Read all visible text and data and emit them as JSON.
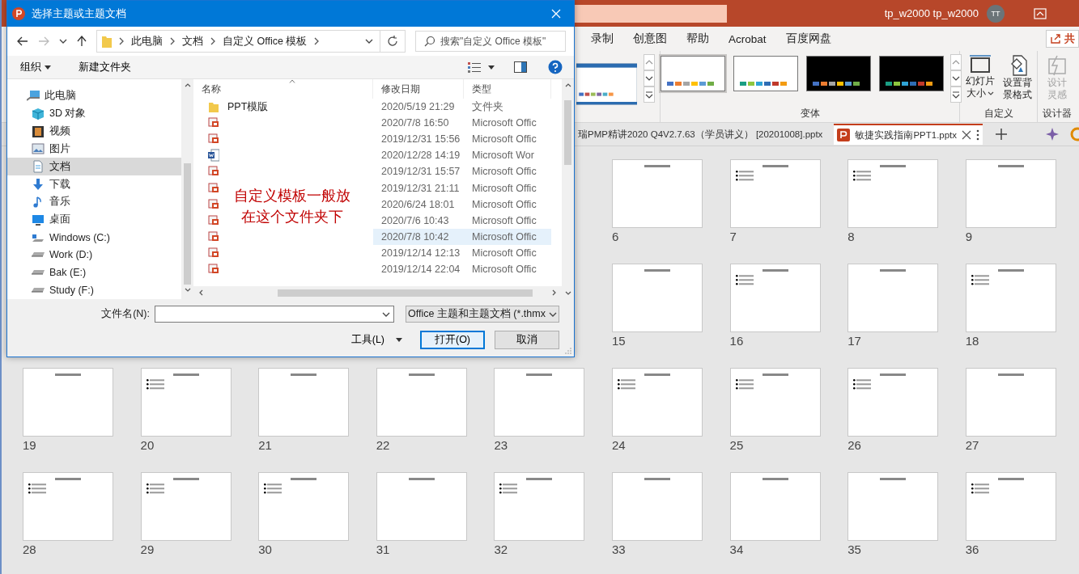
{
  "app": {
    "user": "tp_w2000 tp_w2000",
    "avatar": "TT"
  },
  "ribbon_tabs": [
    {
      "label": "录制"
    },
    {
      "label": "创意图"
    },
    {
      "label": "帮助"
    },
    {
      "label": "Acrobat"
    },
    {
      "label": "百度网盘"
    }
  ],
  "share_button": "共",
  "variants": {
    "label": "变体",
    "items": [
      {
        "kind": "light",
        "selected": true
      },
      {
        "kind": "light",
        "selected": false
      },
      {
        "kind": "dark",
        "selected": false
      },
      {
        "kind": "dark",
        "selected": false
      }
    ]
  },
  "customize": {
    "label": "自定义",
    "buttons": [
      {
        "kind": "size",
        "lines": [
          "幻灯片",
          "大小"
        ],
        "dropdown": true
      },
      {
        "kind": "background",
        "lines": [
          "设置背",
          "景格式"
        ],
        "dropdown": false
      }
    ]
  },
  "designer": {
    "label": "设计器",
    "button": {
      "lines": [
        "设计",
        "灵感"
      ],
      "disabled": true
    }
  },
  "doc_tabs": [
    {
      "label": "瑞PMP精讲2020 Q4V2.7.63（学员讲义） [20201008].pptx",
      "selected": false
    },
    {
      "label": "敏捷实践指南PPT1.pptx",
      "selected": true
    }
  ],
  "slides": [
    {
      "number": "6",
      "kind": "title"
    },
    {
      "number": "7",
      "kind": "bullets"
    },
    {
      "number": "8",
      "kind": "bullets"
    },
    {
      "number": "9",
      "kind": "title"
    },
    {
      "number": "15",
      "kind": "title"
    },
    {
      "number": "16",
      "kind": "bullets"
    },
    {
      "number": "17",
      "kind": "title"
    },
    {
      "number": "18",
      "kind": "bullets"
    },
    {
      "number": "19",
      "kind": "title"
    },
    {
      "number": "20",
      "kind": "bullets"
    },
    {
      "number": "21",
      "kind": "title"
    },
    {
      "number": "22",
      "kind": "title"
    },
    {
      "number": "23",
      "kind": "title"
    },
    {
      "number": "24",
      "kind": "bullets"
    },
    {
      "number": "25",
      "kind": "bullets"
    },
    {
      "number": "26",
      "kind": "bullets"
    },
    {
      "number": "27",
      "kind": "title"
    },
    {
      "number": "28",
      "kind": "bullets"
    },
    {
      "number": "29",
      "kind": "bullets"
    },
    {
      "number": "30",
      "kind": "bullets"
    },
    {
      "number": "31",
      "kind": "title"
    },
    {
      "number": "32",
      "kind": "bullets"
    },
    {
      "number": "33",
      "kind": "title"
    },
    {
      "number": "34",
      "kind": "title"
    },
    {
      "number": "35",
      "kind": "title"
    },
    {
      "number": "36",
      "kind": "bullets"
    }
  ],
  "dialog": {
    "title": "选择主题或主题文档",
    "breadcrumb": [
      "此电脑",
      "文档",
      "自定义 Office 模板"
    ],
    "search": {
      "placeholder": "搜索\"自定义 Office 模板\""
    },
    "toolbar": {
      "organize": "组织",
      "new_folder": "新建文件夹"
    },
    "nav": [
      {
        "label": "此电脑",
        "kind": "pc",
        "selected": false
      },
      {
        "label": "3D 对象",
        "kind": "cube",
        "selected": false
      },
      {
        "label": "视频",
        "kind": "video",
        "selected": false
      },
      {
        "label": "图片",
        "kind": "picture",
        "selected": false
      },
      {
        "label": "文档",
        "kind": "document",
        "selected": true
      },
      {
        "label": "下载",
        "kind": "download",
        "selected": false
      },
      {
        "label": "音乐",
        "kind": "music",
        "selected": false
      },
      {
        "label": "桌面",
        "kind": "desktop",
        "selected": false
      },
      {
        "label": "Windows (C:)",
        "kind": "system-drive",
        "selected": false
      },
      {
        "label": "Work (D:)",
        "kind": "drive",
        "selected": false
      },
      {
        "label": "Bak (E:)",
        "kind": "drive",
        "selected": false
      },
      {
        "label": "Study (F:)",
        "kind": "drive",
        "selected": false
      }
    ],
    "columns": [
      "名称",
      "修改日期",
      "类型"
    ],
    "files": [
      {
        "kind": "folder",
        "name": "PPT模版",
        "date": "2020/5/19 21:29",
        "type": "文件夹",
        "selected": false
      },
      {
        "kind": "ppt",
        "date": "2020/7/8 16:50",
        "type": "Microsoft Offic",
        "selected": false
      },
      {
        "kind": "ppt",
        "date": "2019/12/31 15:56",
        "type": "Microsoft Offic",
        "selected": false
      },
      {
        "kind": "word",
        "date": "2020/12/28 14:19",
        "type": "Microsoft Wor",
        "selected": false
      },
      {
        "kind": "ppt",
        "date": "2019/12/31 15:57",
        "type": "Microsoft Offic",
        "selected": false
      },
      {
        "kind": "ppt",
        "date": "2019/12/31 21:11",
        "type": "Microsoft Offic",
        "selected": false
      },
      {
        "kind": "ppt",
        "date": "2020/6/24 18:01",
        "type": "Microsoft Offic",
        "selected": false
      },
      {
        "kind": "ppt",
        "date": "2020/7/6 10:43",
        "type": "Microsoft Offic",
        "selected": false
      },
      {
        "kind": "ppt",
        "date": "2020/7/8 10:42",
        "type": "Microsoft Offic",
        "selected": true
      },
      {
        "kind": "ppt",
        "date": "2019/12/14 12:13",
        "type": "Microsoft Offic",
        "selected": false
      },
      {
        "kind": "ppt",
        "date": "2019/12/14 22:04",
        "type": "Microsoft Offic",
        "selected": false
      }
    ],
    "filename_label": "文件名(N):",
    "filter": "Office 主题和主题文档 (*.thmx",
    "tools": "工具(L)",
    "open": "打开(O)",
    "cancel": "取消"
  },
  "note": [
    "自定义模板一般放",
    "在这个文件夹下"
  ]
}
